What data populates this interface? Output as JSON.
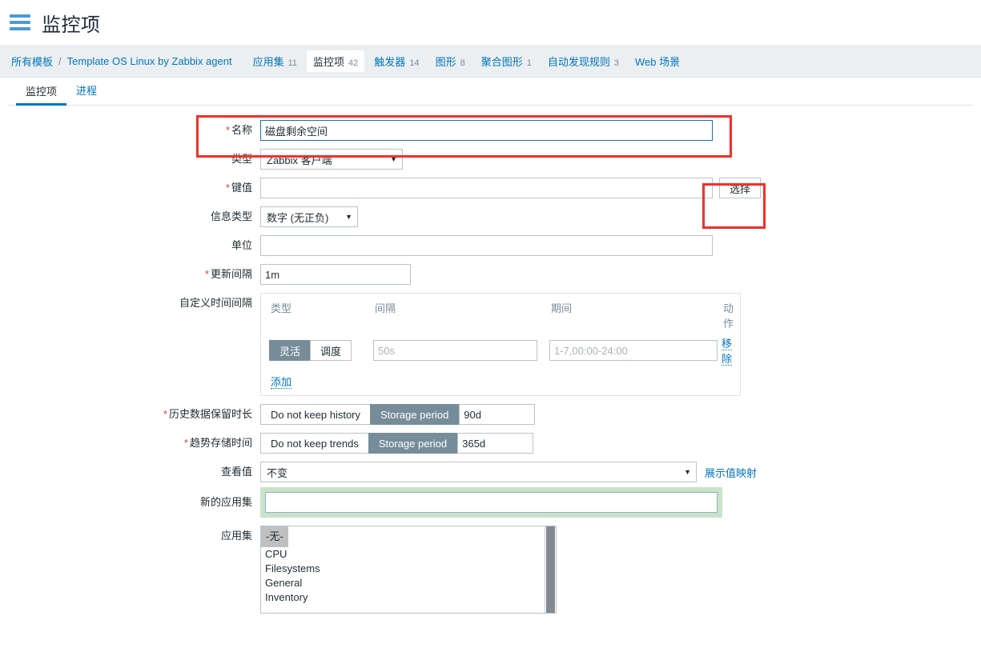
{
  "header": {
    "title": "监控项",
    "menu_icon": "hamburger-icon"
  },
  "breadcrumb": {
    "root": "所有模板",
    "separator": "/",
    "template": "Template OS Linux by Zabbix agent",
    "items": [
      {
        "label": "应用集",
        "count": "11",
        "active": false
      },
      {
        "label": "监控项",
        "count": "42",
        "active": true
      },
      {
        "label": "触发器",
        "count": "14",
        "active": false
      },
      {
        "label": "图形",
        "count": "8",
        "active": false
      },
      {
        "label": "聚合图形",
        "count": "1",
        "active": false
      },
      {
        "label": "自动发现规则",
        "count": "3",
        "active": false
      },
      {
        "label": "Web 场景",
        "count": "",
        "active": false
      }
    ]
  },
  "tabs": [
    {
      "label": "监控项",
      "active": true
    },
    {
      "label": "进程",
      "active": false
    }
  ],
  "form": {
    "name": {
      "label": "名称",
      "required": true,
      "value": "磁盘剩余空间"
    },
    "type": {
      "label": "类型",
      "required": false,
      "value": "Zabbix 客户端"
    },
    "key": {
      "label": "键值",
      "required": true,
      "value": "",
      "button": "选择"
    },
    "value_type": {
      "label": "信息类型",
      "required": false,
      "value": "数字 (无正负)"
    },
    "units": {
      "label": "单位",
      "required": false,
      "value": ""
    },
    "update_interval": {
      "label": "更新间隔",
      "required": true,
      "value": "1m"
    },
    "custom_intervals": {
      "label": "自定义时间间隔",
      "columns": [
        "类型",
        "间隔",
        "期间",
        "动作"
      ],
      "rows": [
        {
          "type_options": [
            {
              "label": "灵活",
              "selected": true
            },
            {
              "label": "调度",
              "selected": false
            }
          ],
          "interval_value": "",
          "interval_placeholder": "50s",
          "period_value": "",
          "period_placeholder": "1-7,00:00-24:00",
          "action": "移除"
        }
      ],
      "add_label": "添加"
    },
    "history": {
      "label": "历史数据保留时长",
      "required": true,
      "options": [
        {
          "label": "Do not keep history",
          "selected": false
        },
        {
          "label": "Storage period",
          "selected": true
        }
      ],
      "value": "90d"
    },
    "trends": {
      "label": "趋势存储时间",
      "required": true,
      "options": [
        {
          "label": "Do not keep trends",
          "selected": false
        },
        {
          "label": "Storage period",
          "selected": true
        }
      ],
      "value": "365d"
    },
    "value_map": {
      "label": "查看值",
      "value": "不变",
      "link": "展示值映射"
    },
    "new_application": {
      "label": "新的应用集",
      "value": ""
    },
    "applications": {
      "label": "应用集",
      "options": [
        {
          "label": "-无-",
          "selected": true
        },
        {
          "label": "CPU",
          "selected": false
        },
        {
          "label": "Filesystems",
          "selected": false
        },
        {
          "label": "General",
          "selected": false
        },
        {
          "label": "Inventory",
          "selected": false
        }
      ]
    }
  },
  "annotations": {
    "highlight_color": "#f0312a",
    "boxes": [
      "name-field-highlight",
      "select-button-highlight"
    ]
  }
}
